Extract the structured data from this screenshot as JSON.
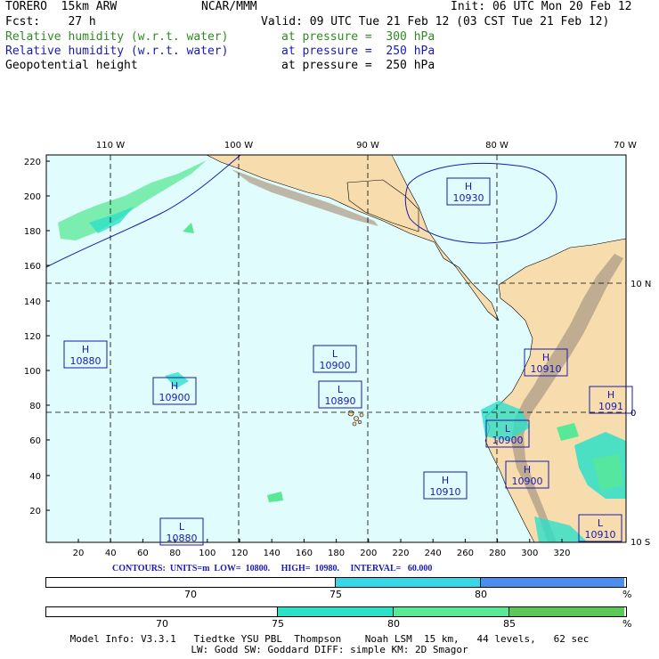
{
  "header": {
    "model": "TORERO  15km ARW",
    "center": "NCAR/MMM",
    "init": "Init: 06 UTC Mon 20 Feb 12",
    "fcst": "Fcst:    27 h",
    "valid": "Valid: 09 UTC Tue 21 Feb 12 (03 CST Tue 21 Feb 12)",
    "fields": [
      {
        "name": "Relative humidity (w.r.t. water)",
        "level": "at pressure =  300 hPa",
        "color": "#2e8b22"
      },
      {
        "name": "Relative humidity (w.r.t. water)",
        "level": "at pressure =  250 hPa",
        "color": "#1a1ab0"
      },
      {
        "name": "Geopotential height",
        "level": "at pressure =  250 hPa",
        "color": "#000000"
      }
    ]
  },
  "map": {
    "lon_labels": [
      "110 W",
      "100 W",
      "90 W",
      "80 W",
      "70 W"
    ],
    "lat_labels": [
      "10 N",
      "0",
      "10 S"
    ],
    "y_ticks": [
      "220",
      "200",
      "180",
      "160",
      "140",
      "120",
      "100",
      "80",
      "60",
      "40",
      "20"
    ],
    "x_ticks": [
      "20",
      "40",
      "60",
      "80",
      "100",
      "120",
      "140",
      "160",
      "180",
      "200",
      "220",
      "240",
      "260",
      "280",
      "300",
      "320"
    ],
    "centers": [
      {
        "type": "H",
        "value": "10930"
      },
      {
        "type": "H",
        "value": "10880"
      },
      {
        "type": "L",
        "value": "10900"
      },
      {
        "type": "L",
        "value": "10890"
      },
      {
        "type": "H",
        "value": "10900"
      },
      {
        "type": "H",
        "value": "10910"
      },
      {
        "type": "H",
        "value": "1091"
      },
      {
        "type": "L",
        "value": "10900"
      },
      {
        "type": "H",
        "value": "10910"
      },
      {
        "type": "H",
        "value": "10900"
      },
      {
        "type": "L",
        "value": "10880"
      },
      {
        "type": "L",
        "value": "10910"
      }
    ],
    "colors": {
      "ocean": "#e0fcfc",
      "land": "#f7dcae",
      "terrain": "#b0a08a",
      "grid": "#000000"
    }
  },
  "contours": "CONTOURS:  UNITS=m  LOW=  10800.     HIGH=  10980.     INTERVAL=   60.000",
  "bar1": {
    "labels": [
      "70",
      "75",
      "80"
    ],
    "unit": "%",
    "colors": [
      "#ffffff",
      "#36d7e6",
      "#4a8ff0"
    ]
  },
  "bar2": {
    "labels": [
      "70",
      "75",
      "80",
      "85"
    ],
    "unit": "%",
    "colors": [
      "#ffffff",
      "#2de0c8",
      "#58e896",
      "#5cc85a"
    ]
  },
  "footer": {
    "line1": "Model Info: V3.3.1   Tiedtke YSU PBL  Thompson    Noah LSM  15 km,   44 levels,   62 sec",
    "line2": "LW: Godd SW: Goddard DIFF: simple KM: 2D Smagor"
  }
}
